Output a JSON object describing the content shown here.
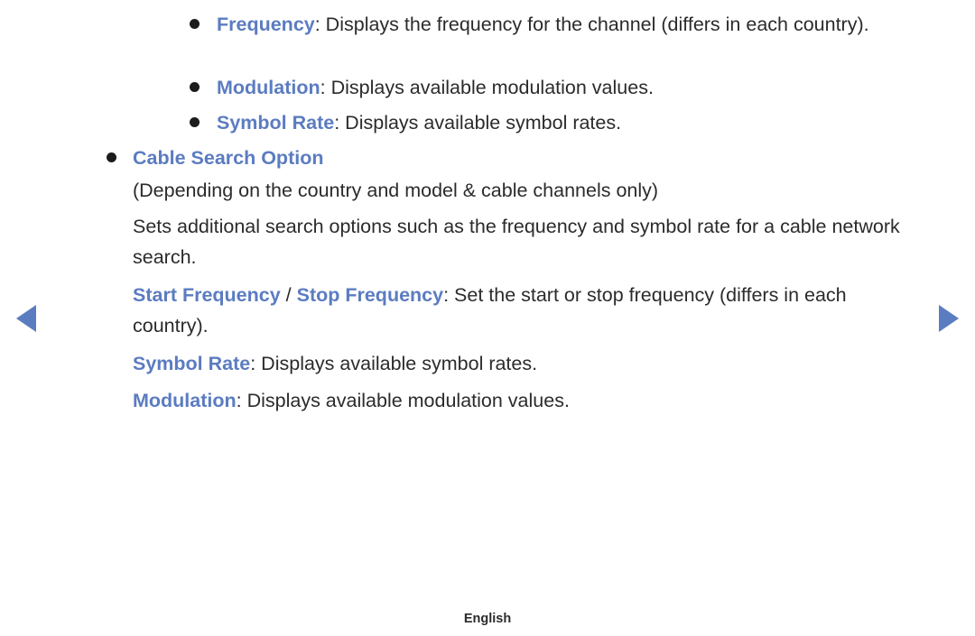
{
  "page": {
    "language_footer": "English",
    "accent_color": "#5b7cc0",
    "body_color": "#2b2b2b",
    "background_color": "#ffffff"
  },
  "navigation": {
    "prev_label": "◀",
    "next_label": "▶",
    "prev_name": "previous-page-arrow",
    "next_name": "next-page-arrow"
  },
  "content": {
    "frequency": {
      "term": "Frequency",
      "body": ": Displays the frequency for the channel (differs in each country)."
    },
    "modulation_top": {
      "term": "Modulation",
      "body": ": Displays available modulation values."
    },
    "symbol_rate_top": {
      "term": "Symbol Rate",
      "body": ": Displays available symbol rates."
    },
    "cable_search_option": {
      "heading": "Cable Search Option",
      "note": "(Depending on the country and model & cable channels only)",
      "description": "Sets additional search options such as the frequency and symbol rate for a cable network search."
    },
    "start_stop_frequency": {
      "term_start": "Start Frequency",
      "separator": " / ",
      "term_stop": "Stop Frequency",
      "body": ": Set the start or stop frequency (differs in each country)."
    },
    "symbol_rate_bottom": {
      "term": "Symbol Rate",
      "body": ": Displays available symbol rates."
    },
    "modulation_bottom": {
      "term": "Modulation",
      "body": ": Displays available modulation values."
    }
  }
}
